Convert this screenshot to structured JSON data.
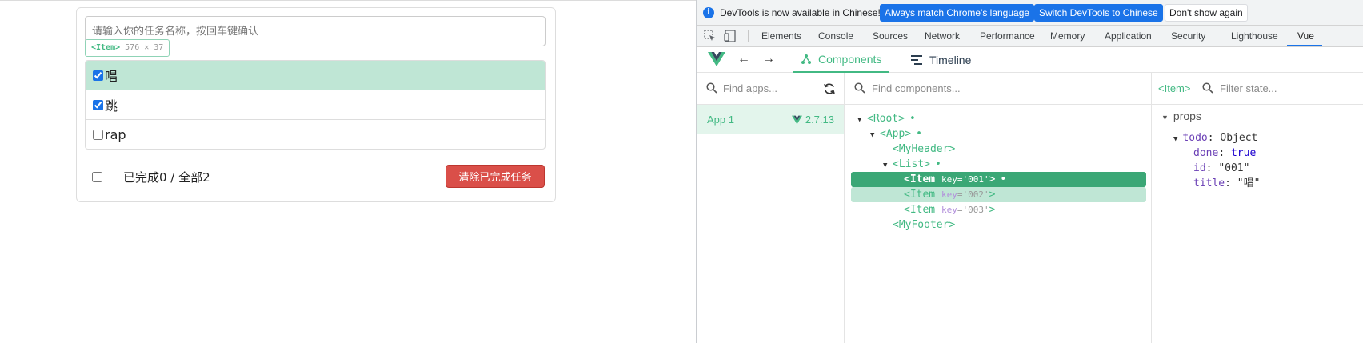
{
  "todo_app": {
    "input_placeholder": "请输入你的任务名称，按回车键确认",
    "hover_tag": {
      "name": "<Item>",
      "size": "576 ✕ 37"
    },
    "items": [
      {
        "title": "唱",
        "done": true
      },
      {
        "title": "跳",
        "done": true
      },
      {
        "title": "rap",
        "done": false
      }
    ],
    "footer": {
      "status": "已完成0 / 全部2",
      "clear_button": "清除已完成任务"
    }
  },
  "devtools": {
    "infobar": {
      "message": "DevTools is now available in Chinese!",
      "btn_match": "Always match Chrome's language",
      "btn_switch": "Switch DevTools to Chinese",
      "btn_dismiss": "Don't show again"
    },
    "tabs": [
      "Elements",
      "Console",
      "Sources",
      "Network",
      "Performance",
      "Memory",
      "Application",
      "Security",
      "Lighthouse",
      "Vue"
    ],
    "active_tab": "Vue",
    "vue": {
      "tool_tabs": {
        "components": "Components",
        "timeline": "Timeline"
      },
      "find_apps_placeholder": "Find apps...",
      "find_components_placeholder": "Find components...",
      "filter_state_placeholder": "Filter state...",
      "app": {
        "name": "App 1",
        "version": "2.7.13"
      },
      "tree": {
        "root": "<Root>",
        "app": "<App>",
        "header": "<MyHeader>",
        "list": "<List>",
        "item_open": "<Item",
        "key_attr": "key",
        "item1_key": "='001'",
        "item2_key": "='002'",
        "item3_key": "='003'",
        "item_close": ">",
        "footer": "<MyFooter>"
      },
      "state": {
        "selected_tag": "<Item>",
        "section": "props",
        "todo_key": "todo",
        "todo_type": "Object",
        "done_key": "done",
        "done_value": "true",
        "id_key": "id",
        "id_value": "\"001\"",
        "title_key": "title",
        "title_value": "\"唱\""
      }
    }
  },
  "colors": {
    "vue_green": "#42b983",
    "chrome_blue": "#1a73e8",
    "danger_red": "#da4f49"
  }
}
